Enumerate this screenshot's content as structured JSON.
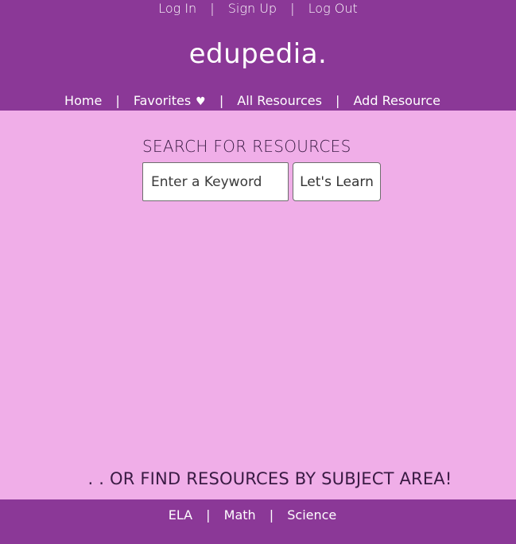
{
  "header": {
    "auth": {
      "login": "Log In",
      "signup": "Sign Up",
      "logout": "Log Out",
      "separator": "|"
    },
    "brand": "edupedia.",
    "nav": {
      "home": "Home",
      "favorites": "Favorites",
      "favorites_icon": "heart-icon",
      "all_resources": "All Resources",
      "add_resource": "Add Resource",
      "separator": "|"
    }
  },
  "search": {
    "title": "SEARCH FOR RESOURCES",
    "placeholder": "Enter a Keyword",
    "button_label": "Let's Learn"
  },
  "subject_area": {
    "title": ". . OR FIND RESOURCES BY SUBJECT AREA!"
  },
  "footer": {
    "links": {
      "ela": "ELA",
      "math": "Math",
      "science": "Science"
    },
    "separator": "|"
  },
  "colors": {
    "header_bg": "#8b3897",
    "page_bg": "#f0aee8",
    "text_dark": "#3a1b44"
  }
}
